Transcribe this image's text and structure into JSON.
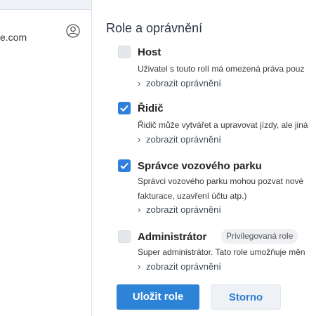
{
  "sidebar": {
    "email_fragment": "e.com",
    "user_icon": "user-circle-icon"
  },
  "roles_section": {
    "title": "Role a oprávnění",
    "roles": [
      {
        "name": "Host",
        "checked": false,
        "description": [
          "Uživatel s touto rolí má omezená práva pouz"
        ],
        "show_permissions": "zobrazit oprávnění"
      },
      {
        "name": "Řidič",
        "checked": true,
        "description": [
          "Řidič může vytvářet a upravovat jízdy, ale jiná"
        ],
        "show_permissions": "zobrazit oprávnění"
      },
      {
        "name": "Správce vozového parku",
        "checked": true,
        "description": [
          "Správci vozového parku mohou pozvat nové",
          "fakturace, uzavření účtu atp.)"
        ],
        "show_permissions": "zobrazit oprávnění"
      },
      {
        "name": "Administrátor",
        "badge": "Privilegovaná role",
        "checked": false,
        "description": [
          "Super administrátor. Tato role umožňuje měn"
        ],
        "show_permissions": "zobrazit oprávnění"
      }
    ]
  },
  "actions": {
    "save_label": "Uložit role",
    "cancel_label": "Storno"
  },
  "colors": {
    "accent": "#2d83d8",
    "checkbox_checked": "#2f80de",
    "checkbox_unchecked": "#e4e8ed"
  }
}
